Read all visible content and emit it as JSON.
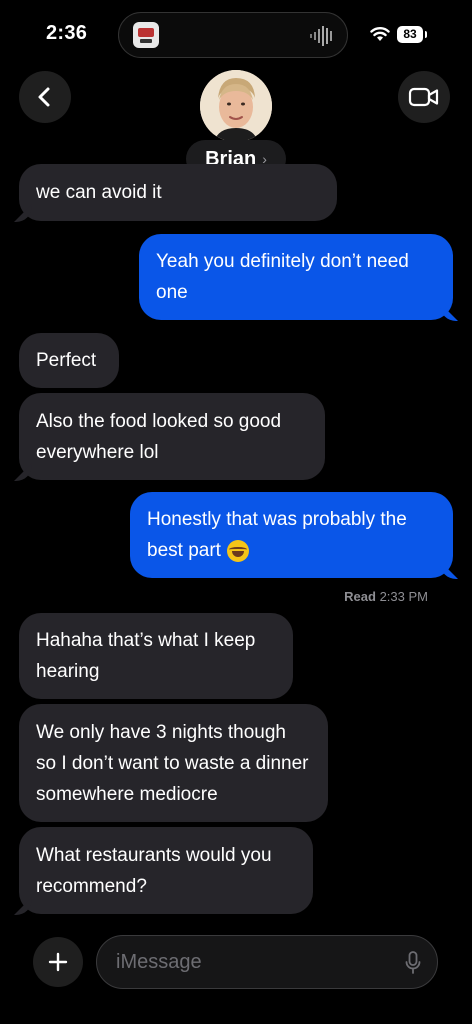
{
  "status_bar": {
    "time": "2:36",
    "battery": "83"
  },
  "header": {
    "contact_name": "Brian",
    "chevron": "›"
  },
  "messages": [
    {
      "dir": "in",
      "text": "we can avoid it"
    },
    {
      "dir": "out",
      "text": "Yeah you definitely don’t need one"
    },
    {
      "dir": "in",
      "text": "Perfect"
    },
    {
      "dir": "in",
      "text": "Also the food looked so good everywhere lol"
    },
    {
      "dir": "out",
      "text": "Honestly that was probably the best part"
    },
    {
      "dir": "in",
      "text": "Hahaha that’s what I keep hearing"
    },
    {
      "dir": "in",
      "text": "We only have 3 nights though so I don’t want to waste a dinner somewhere mediocre"
    },
    {
      "dir": "in",
      "text": "What restaurants would you recommend?"
    }
  ],
  "read_receipt": {
    "label": "Read",
    "time": "2:33 PM"
  },
  "input": {
    "placeholder": "iMessage"
  },
  "icons": {
    "back": "chevron-left-icon",
    "video": "video-camera-icon",
    "plus": "plus-icon",
    "mic": "microphone-icon",
    "wifi": "wifi-icon",
    "emoji": "laughing-emoji-icon"
  },
  "colors": {
    "outgoing": "#0a56e8",
    "incoming": "#26252a",
    "background": "#000000"
  }
}
